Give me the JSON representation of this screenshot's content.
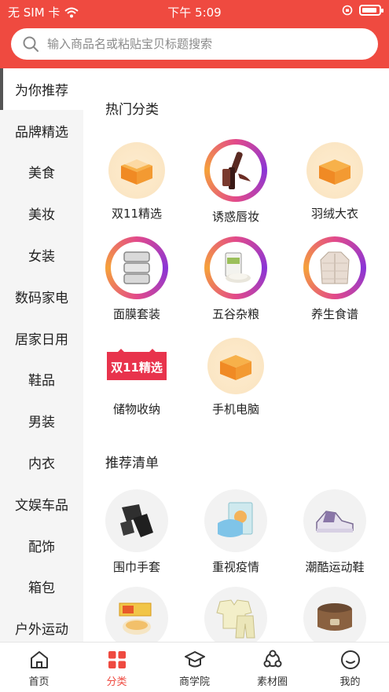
{
  "status_bar": {
    "carrier": "无 SIM 卡",
    "time": "下午 5:09"
  },
  "search": {
    "placeholder": "输入商品名或粘贴宝贝标题搜索"
  },
  "sidebar": {
    "items": [
      {
        "label": "为你推荐",
        "active": true
      },
      {
        "label": "品牌精选"
      },
      {
        "label": "美食"
      },
      {
        "label": "美妆"
      },
      {
        "label": "女装"
      },
      {
        "label": "数码家电"
      },
      {
        "label": "居家日用"
      },
      {
        "label": "鞋品"
      },
      {
        "label": "男装"
      },
      {
        "label": "内衣"
      },
      {
        "label": "文娱车品"
      },
      {
        "label": "配饰"
      },
      {
        "label": "箱包"
      },
      {
        "label": "户外运动"
      }
    ]
  },
  "hot_categories": {
    "title": "热门分类",
    "items": [
      {
        "label": "双11精选",
        "icon": "box-icon"
      },
      {
        "label": "诱惑唇妆",
        "icon": "lipstick-icon"
      },
      {
        "label": "羽绒大衣",
        "icon": "box-icon"
      },
      {
        "label": "面膜套装",
        "icon": "containers-icon"
      },
      {
        "label": "五谷杂粮",
        "icon": "grain-icon"
      },
      {
        "label": "养生食谱",
        "icon": "jacket-icon"
      },
      {
        "label": "储物收纳",
        "icon": "double11-badge-icon",
        "badge_text": "双11精选"
      },
      {
        "label": "手机电脑",
        "icon": "box-icon"
      }
    ]
  },
  "recommend_list": {
    "title": "推荐清单",
    "items": [
      {
        "label": "围巾手套",
        "icon": "scarf-icon"
      },
      {
        "label": "重视疫情",
        "icon": "mask-icon"
      },
      {
        "label": "潮酷运动鞋",
        "icon": "sneaker-icon"
      },
      {
        "label": "",
        "icon": "snack-icon"
      },
      {
        "label": "",
        "icon": "pajamas-icon"
      },
      {
        "label": "",
        "icon": "rice-cooker-icon"
      }
    ]
  },
  "bottom_nav": {
    "items": [
      {
        "label": "首页",
        "icon": "home-icon"
      },
      {
        "label": "分类",
        "icon": "category-icon",
        "active": true
      },
      {
        "label": "商学院",
        "icon": "graduation-cap-icon"
      },
      {
        "label": "素材圈",
        "icon": "material-circle-icon"
      },
      {
        "label": "我的",
        "icon": "profile-icon"
      }
    ]
  },
  "colors": {
    "brand": "#ef4a40",
    "sidebar_bg": "#f5f5f5"
  }
}
